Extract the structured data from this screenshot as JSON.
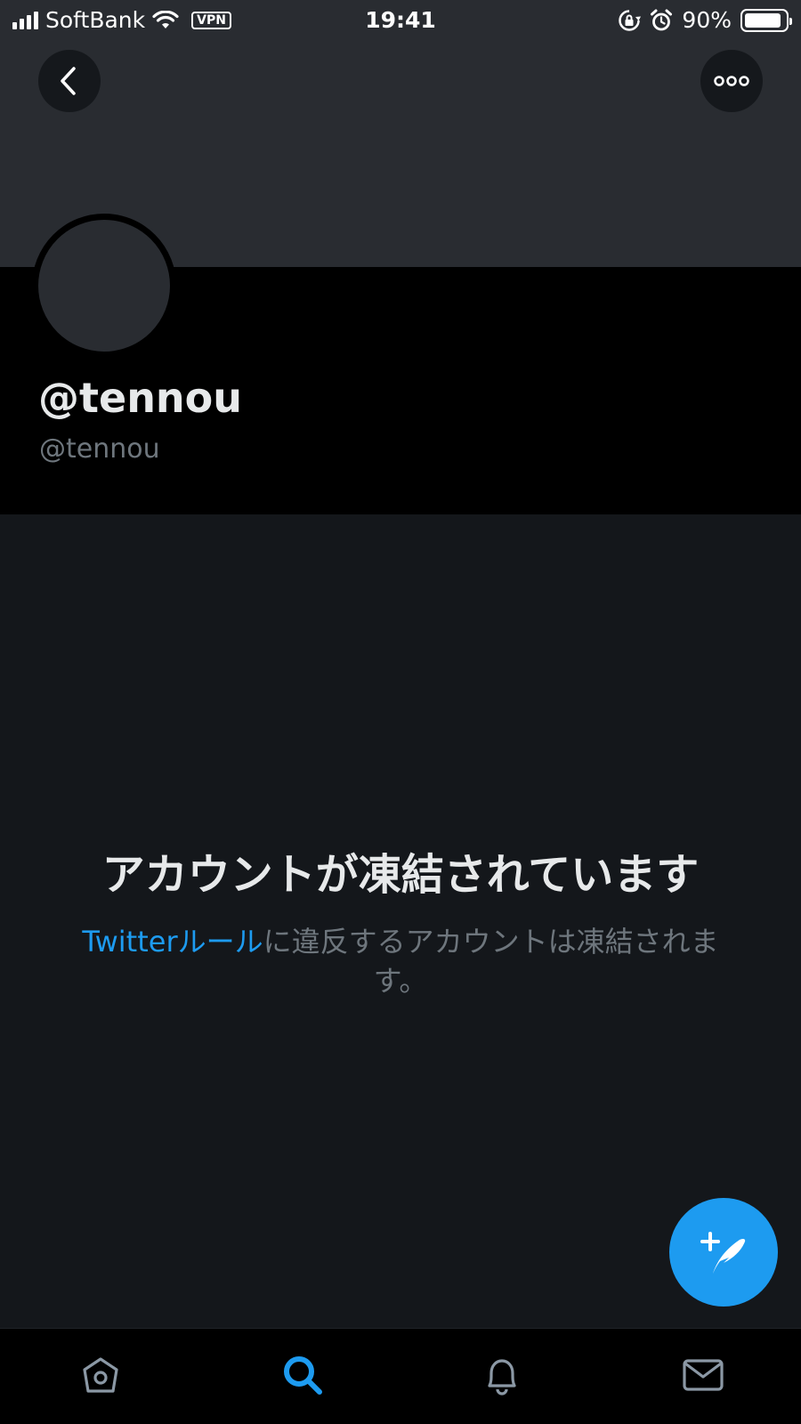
{
  "status_bar": {
    "carrier": "SoftBank",
    "vpn": "VPN",
    "time": "19:41",
    "battery": "90%",
    "battery_level": 0.9
  },
  "header": {
    "back_icon": "chevron-left-icon",
    "more_icon": "more-horizontal-icon"
  },
  "profile": {
    "display_name": "@tennou",
    "handle": "@tennou"
  },
  "suspended": {
    "title": "アカウントが凍結されています",
    "link_text": "Twitterルール",
    "description": "に違反するアカウントは凍結されます。"
  },
  "fab": {
    "icon": "compose-tweet-icon"
  },
  "tabbar": {
    "tabs": [
      {
        "icon": "home-icon",
        "active": false
      },
      {
        "icon": "search-icon",
        "active": true
      },
      {
        "icon": "bell-icon",
        "active": false
      },
      {
        "icon": "mail-icon",
        "active": false
      }
    ]
  },
  "colors": {
    "accent": "#1d9bf0",
    "banner": "#292c31",
    "background": "#14171b",
    "secondary_text": "#6e767d"
  }
}
